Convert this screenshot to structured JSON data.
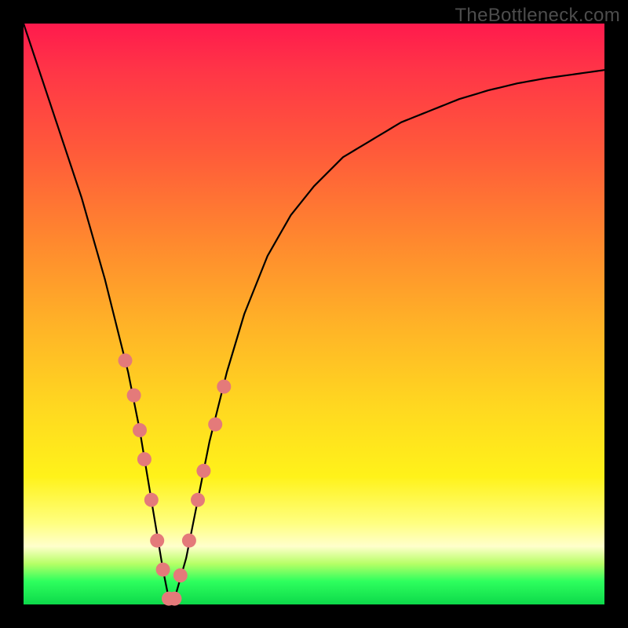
{
  "watermark": "TheBottleneck.com",
  "colors": {
    "frame": "#000000",
    "curve": "#000000",
    "marker_fill": "#e47a7a",
    "marker_stroke": "#c95a5a"
  },
  "chart_data": {
    "type": "line",
    "title": "",
    "xlabel": "",
    "ylabel": "",
    "xlim": [
      0,
      100
    ],
    "ylim": [
      0,
      100
    ],
    "series": [
      {
        "name": "bottleneck-curve",
        "x": [
          0,
          2,
          4,
          6,
          8,
          10,
          12,
          14,
          16,
          18,
          20,
          22,
          24,
          25,
          26,
          28,
          30,
          32,
          35,
          38,
          42,
          46,
          50,
          55,
          60,
          65,
          70,
          75,
          80,
          85,
          90,
          95,
          100
        ],
        "y": [
          100,
          94,
          88,
          82,
          76,
          70,
          63,
          56,
          48,
          40,
          30,
          18,
          6,
          1,
          1,
          8,
          18,
          28,
          40,
          50,
          60,
          67,
          72,
          77,
          80,
          83,
          85,
          87,
          88.5,
          89.7,
          90.6,
          91.3,
          92
        ]
      }
    ],
    "markers": {
      "name": "highlighted-points",
      "x": [
        17.5,
        19.0,
        20.0,
        20.8,
        22.0,
        23.0,
        24.0,
        25.0,
        26.0,
        27.0,
        28.5,
        30.0,
        31.0,
        33.0,
        34.5
      ],
      "y": [
        42.0,
        36.0,
        30.0,
        25.0,
        18.0,
        11.0,
        6.0,
        1.0,
        1.0,
        5.0,
        11.0,
        18.0,
        23.0,
        31.0,
        37.5
      ]
    }
  }
}
